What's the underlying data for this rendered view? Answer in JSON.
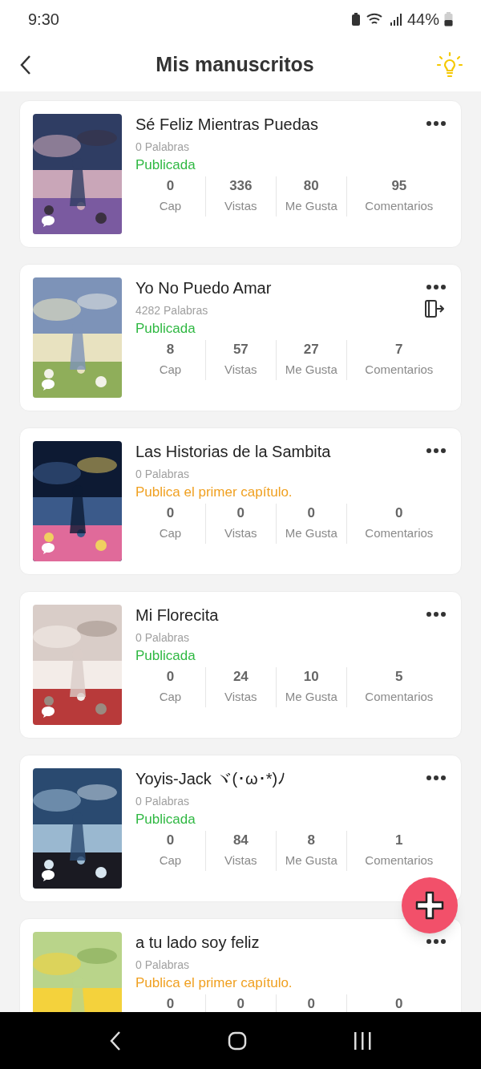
{
  "status_bar": {
    "time": "9:30",
    "battery": "44%"
  },
  "header": {
    "title": "Mis manuscritos"
  },
  "books": [
    {
      "title": "Sé Feliz Mientras Puedas",
      "words": "0 Palabras",
      "status": {
        "kind": "published",
        "text": "Publicada"
      },
      "export_icon": false,
      "stats": [
        {
          "value": "0",
          "label": "Cap"
        },
        {
          "value": "336",
          "label": "Vistas"
        },
        {
          "value": "80",
          "label": "Me Gusta"
        },
        {
          "value": "95",
          "label": "Comentarios"
        }
      ]
    },
    {
      "title": "Yo No Puedo Amar",
      "words": "4282 Palabras",
      "status": {
        "kind": "published",
        "text": "Publicada"
      },
      "export_icon": true,
      "stats": [
        {
          "value": "8",
          "label": "Cap"
        },
        {
          "value": "57",
          "label": "Vistas"
        },
        {
          "value": "27",
          "label": "Me Gusta"
        },
        {
          "value": "7",
          "label": "Comentarios"
        }
      ]
    },
    {
      "title": "Las Historias de la Sambita",
      "words": "0 Palabras",
      "status": {
        "kind": "draft",
        "text": "Publica el primer capítulo."
      },
      "export_icon": false,
      "stats": [
        {
          "value": "0",
          "label": "Cap"
        },
        {
          "value": "0",
          "label": "Vistas"
        },
        {
          "value": "0",
          "label": "Me Gusta"
        },
        {
          "value": "0",
          "label": "Comentarios"
        }
      ]
    },
    {
      "title": "Mi Florecita",
      "words": "0 Palabras",
      "status": {
        "kind": "published",
        "text": "Publicada"
      },
      "export_icon": false,
      "stats": [
        {
          "value": "0",
          "label": "Cap"
        },
        {
          "value": "24",
          "label": "Vistas"
        },
        {
          "value": "10",
          "label": "Me Gusta"
        },
        {
          "value": "5",
          "label": "Comentarios"
        }
      ]
    },
    {
      "title": "Yoyis-Jack ヾ(･ω･*)ﾉ",
      "words": "0 Palabras",
      "status": {
        "kind": "published",
        "text": "Publicada"
      },
      "export_icon": false,
      "stats": [
        {
          "value": "0",
          "label": "Cap"
        },
        {
          "value": "84",
          "label": "Vistas"
        },
        {
          "value": "8",
          "label": "Me Gusta"
        },
        {
          "value": "1",
          "label": "Comentarios"
        }
      ]
    },
    {
      "title": "a tu lado soy feliz",
      "words": "0 Palabras",
      "status": {
        "kind": "draft",
        "text": "Publica el primer capítulo."
      },
      "export_icon": false,
      "stats": [
        {
          "value": "0"
        },
        {
          "value": "0"
        },
        {
          "value": "0"
        },
        {
          "value": "0"
        }
      ]
    }
  ]
}
